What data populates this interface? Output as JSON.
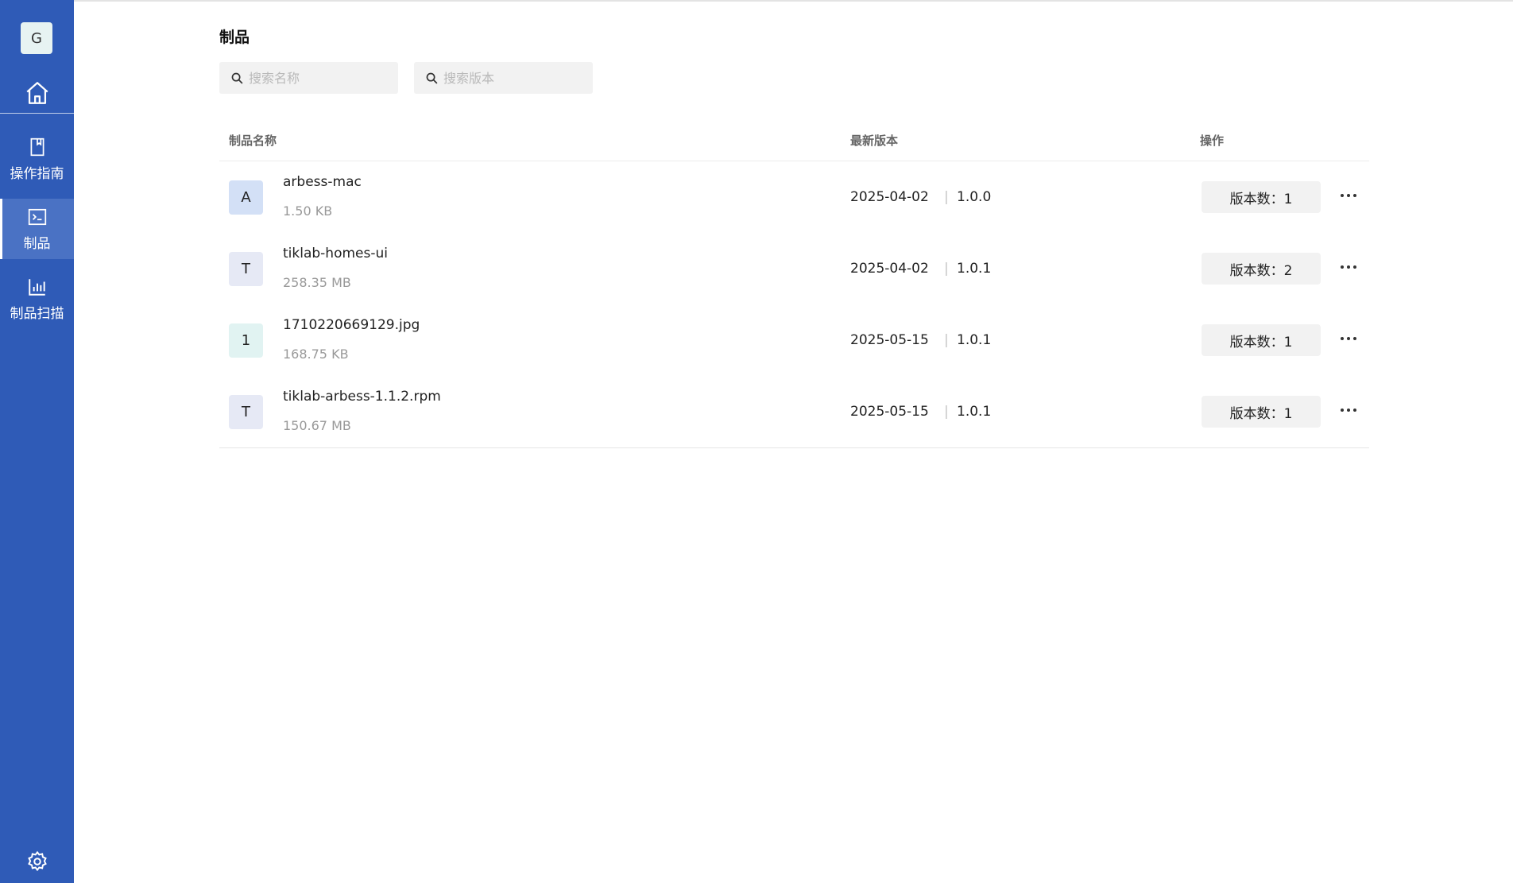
{
  "sidebar": {
    "logo_letter": "G",
    "home_icon": "home-icon",
    "items": [
      {
        "label": "操作指南",
        "icon": "book-icon"
      },
      {
        "label": "制品",
        "icon": "terminal-icon",
        "active": true
      },
      {
        "label": "制品扫描",
        "icon": "bar-chart-icon"
      }
    ],
    "settings_icon": "gear-icon"
  },
  "page": {
    "title": "制品"
  },
  "search": {
    "name_placeholder": "搜索名称",
    "version_placeholder": "搜索版本",
    "icon": "search-icon"
  },
  "table": {
    "headers": {
      "name": "制品名称",
      "version": "最新版本",
      "action": "操作"
    },
    "rows": [
      {
        "letter": "A",
        "avatar_color": "#d3e0f6",
        "name": "arbess-mac",
        "size": "1.50 KB",
        "date": "2025-04-02",
        "version": "1.0.0",
        "count": "版本数：1"
      },
      {
        "letter": "T",
        "avatar_color": "#e6e9f5",
        "name": "tiklab-homes-ui",
        "size": "258.35 MB",
        "date": "2025-04-02",
        "version": "1.0.1",
        "count": "版本数：2"
      },
      {
        "letter": "1",
        "avatar_color": "#e1f3f2",
        "name": "1710220669129.jpg",
        "size": "168.75 KB",
        "date": "2025-05-15",
        "version": "1.0.1",
        "count": "版本数：1"
      },
      {
        "letter": "T",
        "avatar_color": "#e6e9f5",
        "name": "tiklab-arbess-1.1.2.rpm",
        "size": "150.67 MB",
        "date": "2025-05-15",
        "version": "1.0.1",
        "count": "版本数：1"
      }
    ],
    "separator": "|",
    "more_icon": "more-icon"
  },
  "colors": {
    "sidebar_bg": "#2f5bb7",
    "sidebar_active_bg": "#4a72c4",
    "button_bg": "#f2f2f2"
  }
}
